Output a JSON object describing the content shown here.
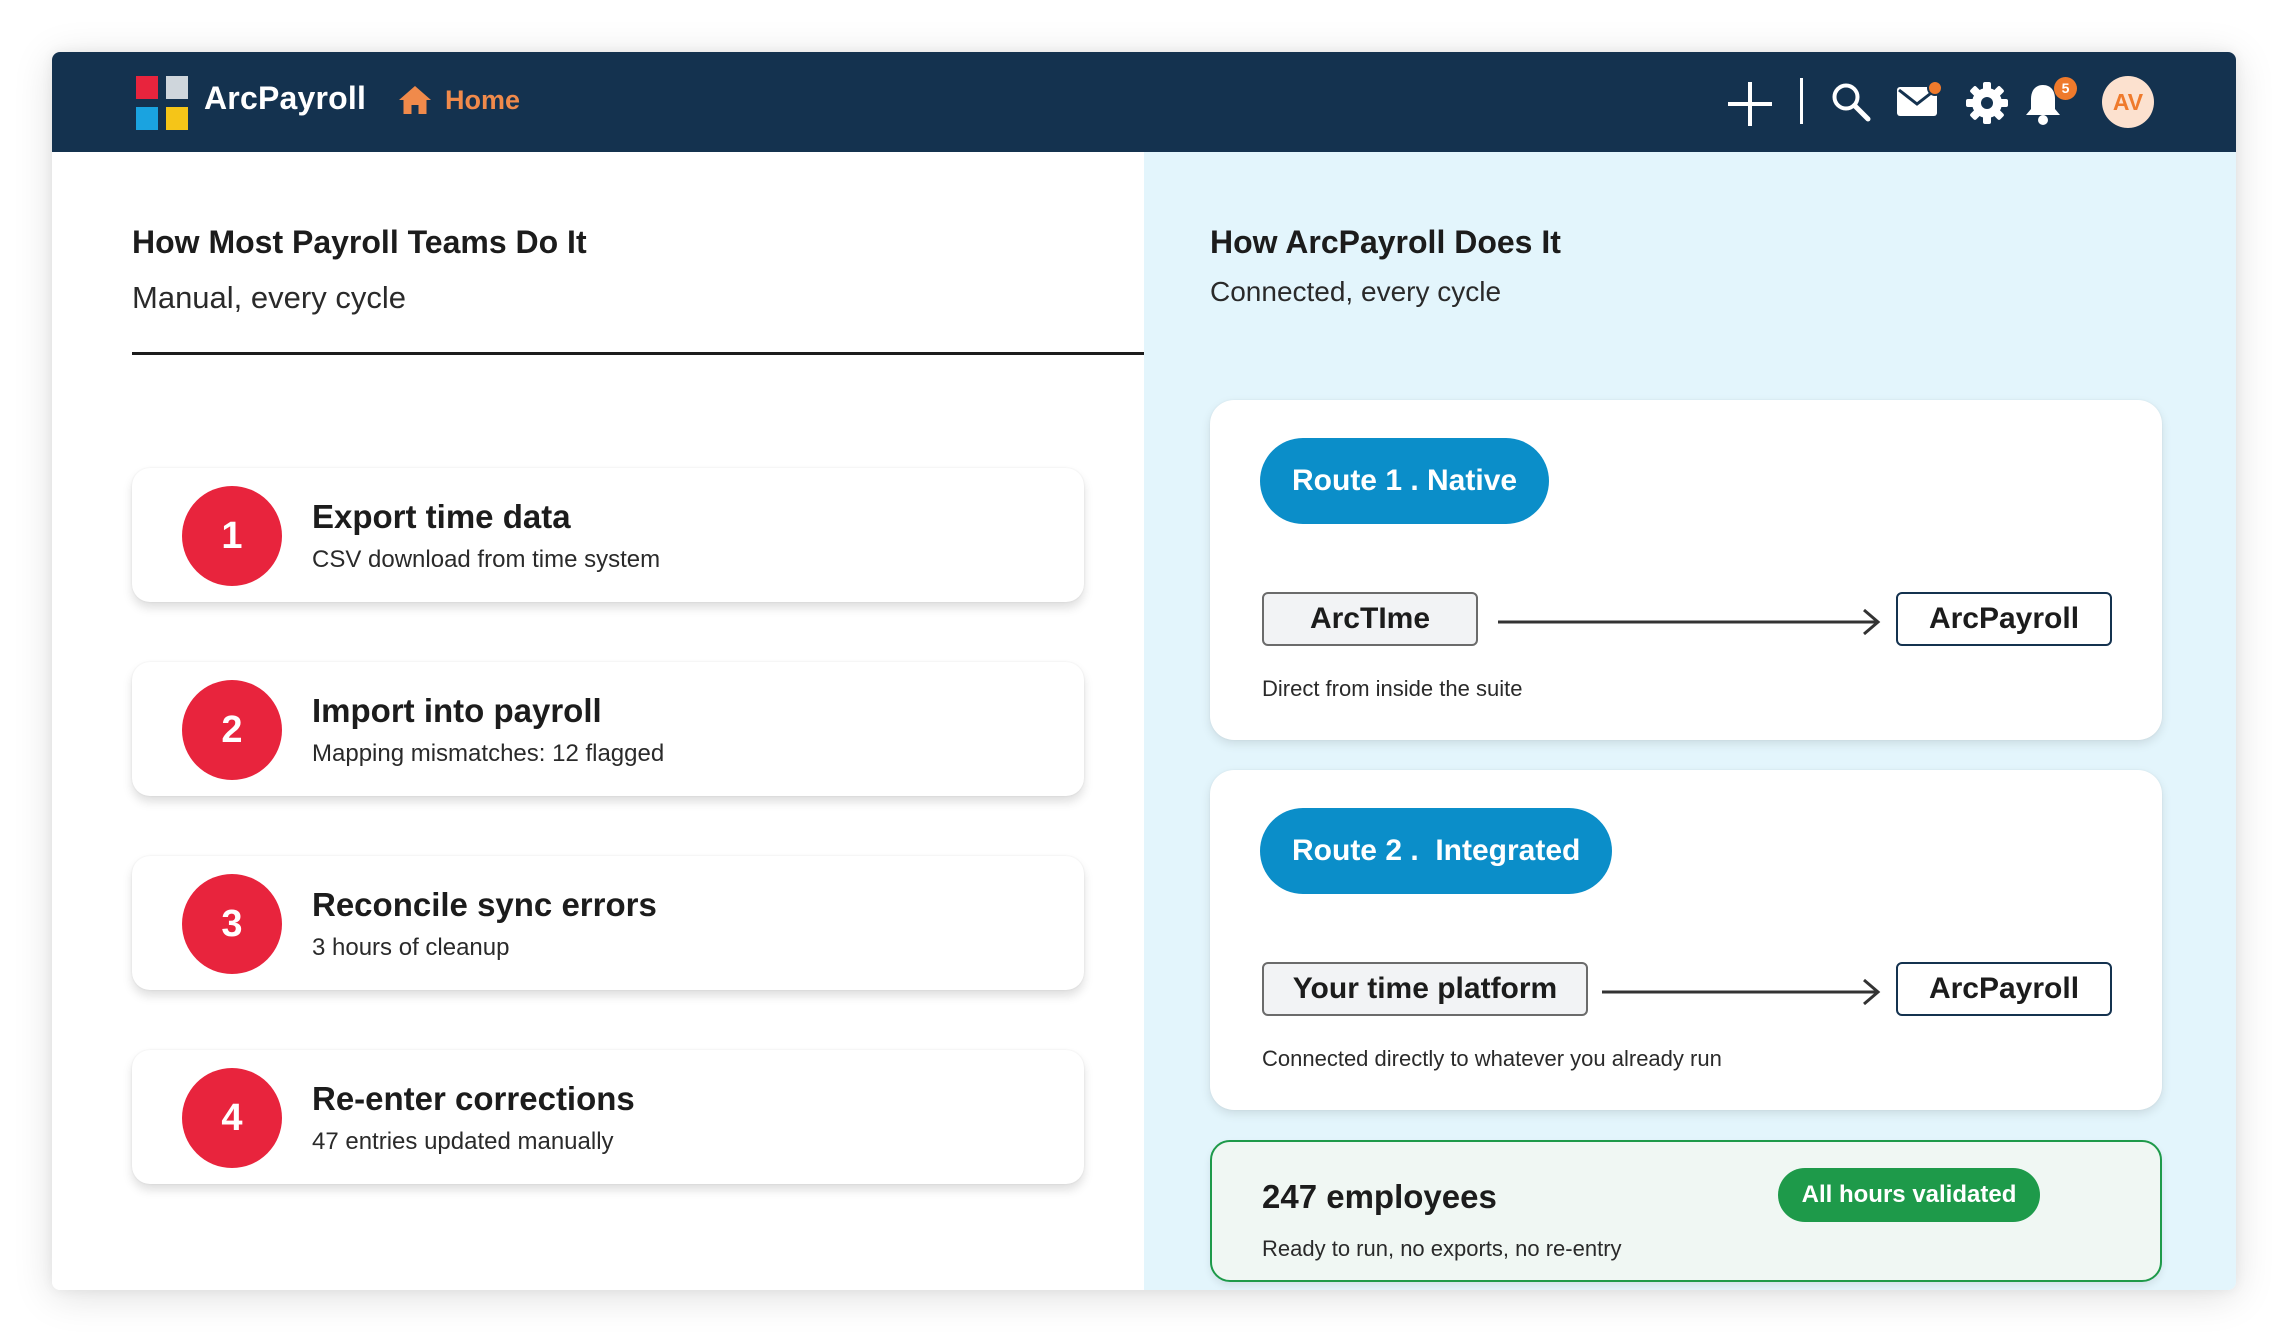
{
  "app": {
    "brand": "ArcPayroll",
    "home_label": "Home",
    "logo_colors": [
      "#e8243d",
      "#cfd6dc",
      "#1aa3e0",
      "#f5c518"
    ],
    "header_bg": "#14324f",
    "accent": "#f08a4b"
  },
  "toolbar": {
    "icons": [
      "plus-icon",
      "search-icon",
      "mail-icon",
      "gear-icon",
      "bell-icon"
    ],
    "notification_count": "5",
    "avatar_initials": "AV"
  },
  "left": {
    "title": "How Most Payroll Teams Do It",
    "subtitle": "Manual, every cycle",
    "steps": [
      {
        "number": "1",
        "title": "Export time data",
        "desc": "CSV download from time system"
      },
      {
        "number": "2",
        "title": "Import into payroll",
        "desc": "Mapping mismatches: 12 flagged"
      },
      {
        "number": "3",
        "title": "Reconcile sync errors",
        "desc": "3 hours of cleanup"
      },
      {
        "number": "4",
        "title": "Re-enter corrections",
        "desc": "47 entries updated manually"
      }
    ]
  },
  "right": {
    "title": "How ArcPayroll Does It",
    "subtitle": "Connected, every cycle",
    "routes": [
      {
        "label": "Route 1 . Native",
        "source": "ArcTIme",
        "destination": "ArcPayroll",
        "note": "Direct from inside the suite"
      },
      {
        "label": "Route 2 .  Integrated",
        "source": "Your time platform",
        "destination": "ArcPayroll",
        "note": "Connected directly to whatever you already run"
      }
    ],
    "summary": {
      "title": "247 employees",
      "badge": "All hours validated",
      "note": "Ready to run, no exports, no re-entry"
    }
  }
}
